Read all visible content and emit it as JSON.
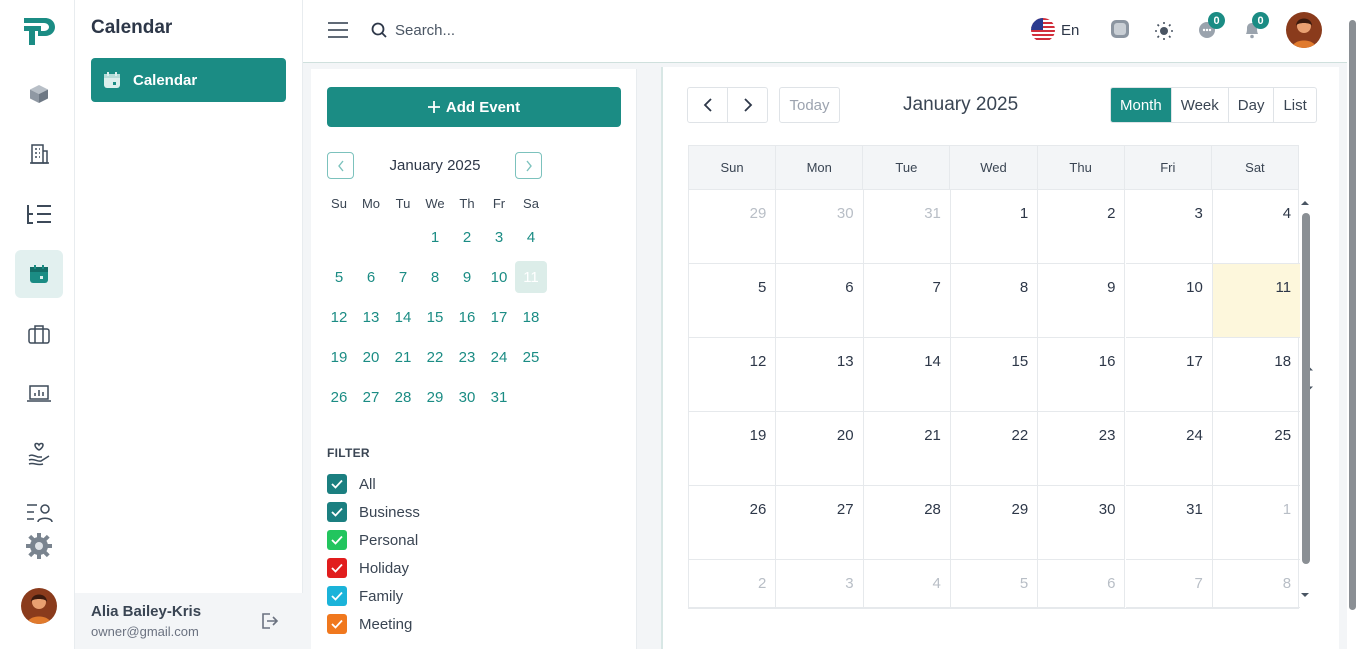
{
  "sidebar": {
    "title": "Calendar",
    "active_item": "Calendar",
    "user_name": "Alia Bailey-Kris",
    "user_email": "owner@gmail.com"
  },
  "header": {
    "search_placeholder": "Search...",
    "language": "En",
    "notifications_count_1": "0",
    "notifications_count_2": "0"
  },
  "mini_calendar": {
    "add_event_label": "Add Event",
    "month_title": "January 2025",
    "weekdays": [
      "Su",
      "Mo",
      "Tu",
      "We",
      "Th",
      "Fr",
      "Sa"
    ],
    "weeks": [
      [
        "",
        "",
        "",
        "1",
        "2",
        "3",
        "4"
      ],
      [
        "5",
        "6",
        "7",
        "8",
        "9",
        "10",
        "11"
      ],
      [
        "12",
        "13",
        "14",
        "15",
        "16",
        "17",
        "18"
      ],
      [
        "19",
        "20",
        "21",
        "22",
        "23",
        "24",
        "25"
      ],
      [
        "26",
        "27",
        "28",
        "29",
        "30",
        "31",
        ""
      ]
    ],
    "selected_day": "11"
  },
  "filter": {
    "title": "FILTER",
    "items": [
      {
        "label": "All",
        "color": "#1b7f80",
        "checked": true
      },
      {
        "label": "Business",
        "color": "#1b7f80",
        "checked": true
      },
      {
        "label": "Personal",
        "color": "#22c55e",
        "checked": true
      },
      {
        "label": "Holiday",
        "color": "#e11d1d",
        "checked": true
      },
      {
        "label": "Family",
        "color": "#1bb3d9",
        "checked": true
      },
      {
        "label": "Meeting",
        "color": "#f0781e",
        "checked": true
      }
    ]
  },
  "calendar": {
    "today_label": "Today",
    "title": "January 2025",
    "views": [
      "Month",
      "Week",
      "Day",
      "List"
    ],
    "active_view": "Month",
    "weekdays": [
      "Sun",
      "Mon",
      "Tue",
      "Wed",
      "Thu",
      "Fri",
      "Sat"
    ],
    "weeks": [
      [
        {
          "d": "29",
          "m": true
        },
        {
          "d": "30",
          "m": true
        },
        {
          "d": "31",
          "m": true
        },
        {
          "d": "1"
        },
        {
          "d": "2"
        },
        {
          "d": "3"
        },
        {
          "d": "4"
        }
      ],
      [
        {
          "d": "5"
        },
        {
          "d": "6"
        },
        {
          "d": "7"
        },
        {
          "d": "8"
        },
        {
          "d": "9"
        },
        {
          "d": "10"
        },
        {
          "d": "11",
          "t": true
        }
      ],
      [
        {
          "d": "12"
        },
        {
          "d": "13"
        },
        {
          "d": "14"
        },
        {
          "d": "15"
        },
        {
          "d": "16"
        },
        {
          "d": "17"
        },
        {
          "d": "18"
        }
      ],
      [
        {
          "d": "19"
        },
        {
          "d": "20"
        },
        {
          "d": "21"
        },
        {
          "d": "22"
        },
        {
          "d": "23"
        },
        {
          "d": "24"
        },
        {
          "d": "25"
        }
      ],
      [
        {
          "d": "26"
        },
        {
          "d": "27"
        },
        {
          "d": "28"
        },
        {
          "d": "29"
        },
        {
          "d": "30"
        },
        {
          "d": "31"
        },
        {
          "d": "1",
          "m": true
        }
      ],
      [
        {
          "d": "2",
          "m": true
        },
        {
          "d": "3",
          "m": true
        },
        {
          "d": "4",
          "m": true
        },
        {
          "d": "5",
          "m": true
        },
        {
          "d": "6",
          "m": true
        },
        {
          "d": "7",
          "m": true
        },
        {
          "d": "8",
          "m": true
        }
      ]
    ]
  },
  "colors": {
    "accent": "#1b8c84",
    "today_bg": "#fdf7dc"
  }
}
